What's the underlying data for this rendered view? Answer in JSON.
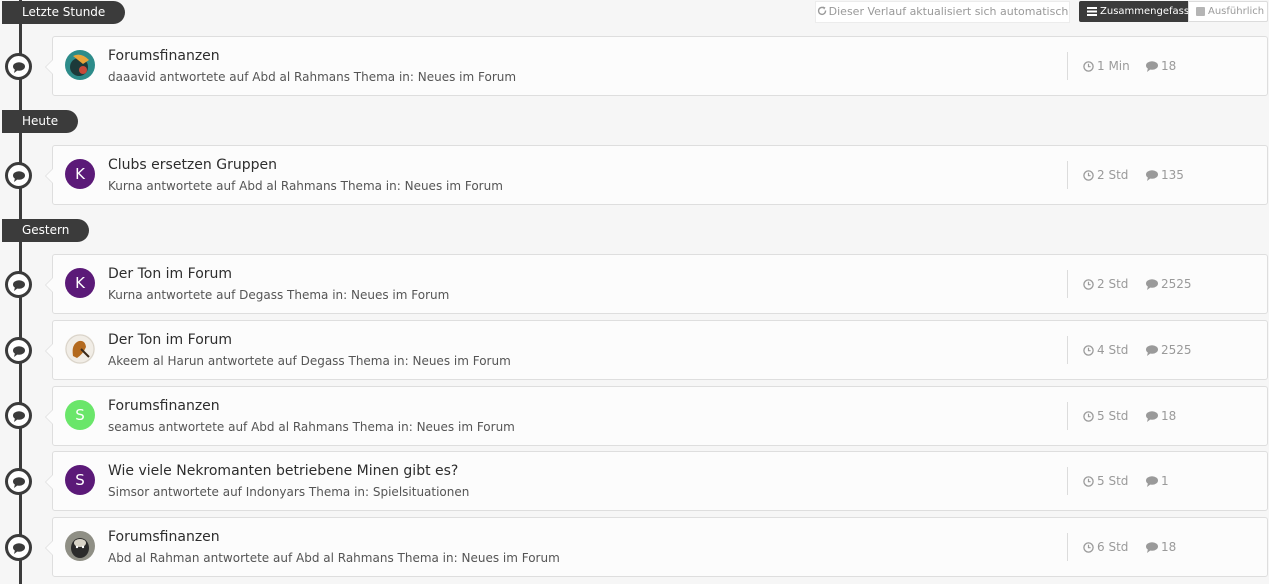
{
  "header": {
    "auto_refresh": "Dieser Verlauf aktualisiert sich automatisch",
    "view_summary": "Zusammengefasst",
    "view_detailed": "Ausführlich"
  },
  "groups": [
    {
      "label": "Letzte Stunde"
    },
    {
      "label": "Heute"
    },
    {
      "label": "Gestern"
    }
  ],
  "colors": {
    "timeline": "#3b3b3b",
    "avatar_purple": "#5b1a78",
    "avatar_green": "#6ae66a"
  },
  "items": [
    {
      "title": "Forumsfinanzen",
      "subtitle": "daaavid antwortete auf Abd al Rahmans Thema in: Neues im Forum",
      "time": "1 Min",
      "replies": "18",
      "avatar": "image"
    },
    {
      "title": "Clubs ersetzen Gruppen",
      "subtitle": "Kurna antwortete auf Abd al Rahmans Thema in: Neues im Forum",
      "time": "2 Std",
      "replies": "135",
      "avatar_letter": "K"
    },
    {
      "title": "Der Ton im Forum",
      "subtitle": "Kurna antwortete auf Degass Thema in: Neues im Forum",
      "time": "2 Std",
      "replies": "2525",
      "avatar_letter": "K"
    },
    {
      "title": "Der Ton im Forum",
      "subtitle": "Akeem al Harun antwortete auf Degass Thema in: Neues im Forum",
      "time": "4 Std",
      "replies": "2525",
      "avatar": "image"
    },
    {
      "title": "Forumsfinanzen",
      "subtitle": "seamus antwortete auf Abd al Rahmans Thema in: Neues im Forum",
      "time": "5 Std",
      "replies": "18",
      "avatar_letter": "S"
    },
    {
      "title": "Wie viele Nekromanten betriebene Minen gibt es?",
      "subtitle": "Simsor antwortete auf Indonyars Thema in: Spielsituationen",
      "time": "5 Std",
      "replies": "1",
      "avatar_letter": "S"
    },
    {
      "title": "Forumsfinanzen",
      "subtitle": "Abd al Rahman antwortete auf Abd al Rahmans Thema in: Neues im Forum",
      "time": "6 Std",
      "replies": "18",
      "avatar": "image"
    }
  ]
}
